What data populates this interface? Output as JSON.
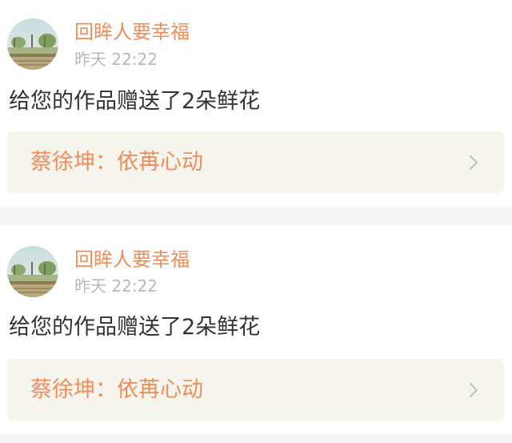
{
  "colors": {
    "accent": "#ef8d5b",
    "link_card_bg": "#f5f5ee",
    "chevron": "#c2c2bc",
    "page_bg": "#f7f4f5"
  },
  "notifications": [
    {
      "username": "回眸人要幸福",
      "time": "昨天 22:22",
      "message": "给您的作品赠送了2朵鲜花",
      "work_title": "蔡徐坤：依苒心动",
      "avatar_icon": "landscape-avatar",
      "chevron_icon": "chevron-right-icon"
    },
    {
      "username": "回眸人要幸福",
      "time": "昨天 22:22",
      "message": "给您的作品赠送了2朵鲜花",
      "work_title": "蔡徐坤：依苒心动",
      "avatar_icon": "landscape-avatar",
      "chevron_icon": "chevron-right-icon"
    }
  ]
}
